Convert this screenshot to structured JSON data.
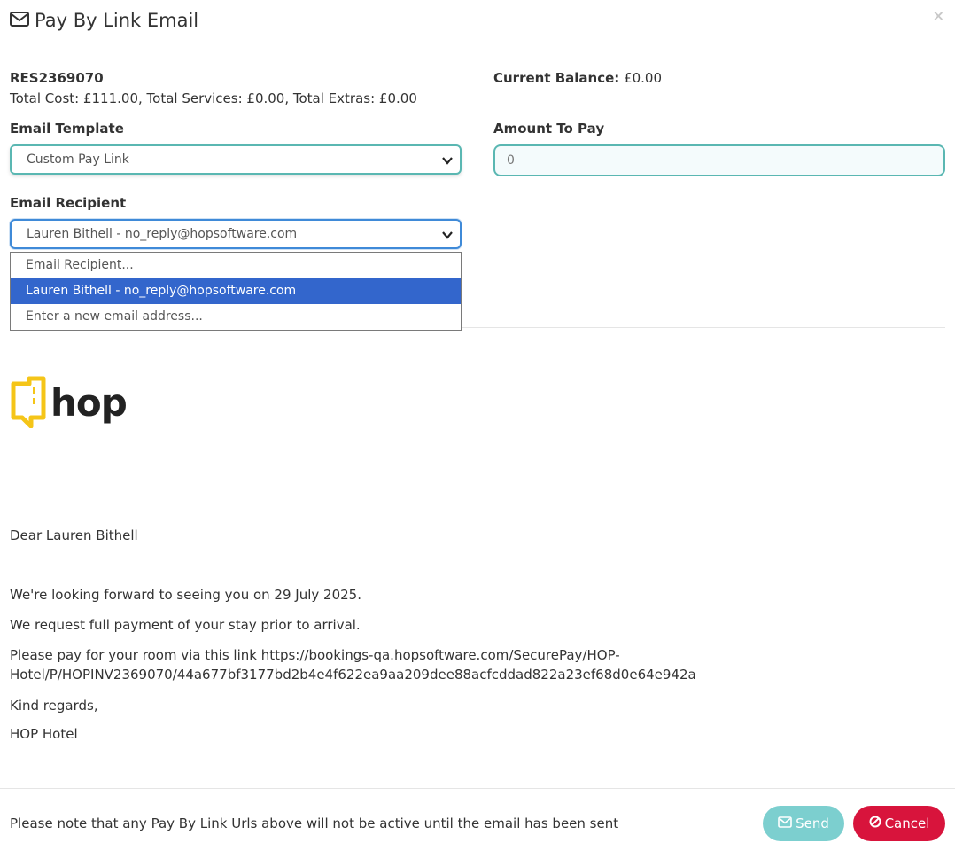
{
  "modal": {
    "title": "Pay By Link Email",
    "close_label": "×"
  },
  "reservation": {
    "ref": "RES2369070",
    "totals": "Total Cost: £111.00, Total Services: £0.00, Total Extras: £0.00",
    "balance_label": "Current Balance:",
    "balance_value": "£0.00"
  },
  "form": {
    "template_label": "Email Template",
    "template_value": "Custom Pay Link",
    "amount_label": "Amount To Pay",
    "amount_value": "0",
    "recipient_label": "Email Recipient",
    "recipient_value": "Lauren Bithell - no_reply@hopsoftware.com",
    "recipient_options": [
      "Email Recipient...",
      "Lauren Bithell - no_reply@hopsoftware.com",
      "Enter a new email address..."
    ],
    "recipient_selected_index": 1
  },
  "preview": {
    "logo_text": "hop",
    "greeting": "Dear Lauren Bithell",
    "line1": "We're looking forward to seeing you on 29 July 2025.",
    "line2": "We request full payment of your stay prior to arrival.",
    "line3a": "Please pay for your room via this link https://bookings-qa.hopsoftware.com/SecurePay/HOP-",
    "line3b": "Hotel/P/HOPINV2369070/44a677bf3177bd2b4e4f622ea9aa209dee88acfcddad822a23ef68d0e64e942a",
    "signoff": "Kind regards,",
    "signature": "HOP Hotel"
  },
  "footer": {
    "note": "Please note that any Pay By Link Urls above will not be active until the email has been sent",
    "send_label": "Send",
    "cancel_label": "Cancel"
  },
  "colors": {
    "teal": "#5ab7b2",
    "send_bg": "#7ccfcf",
    "cancel_bg": "#d8143c",
    "selected_bg": "#3366cc",
    "logo_yellow": "#f5c518"
  },
  "icons": [
    "envelope-icon",
    "close-icon",
    "chevron-down-icon",
    "hop-logo-icon",
    "ban-icon"
  ]
}
